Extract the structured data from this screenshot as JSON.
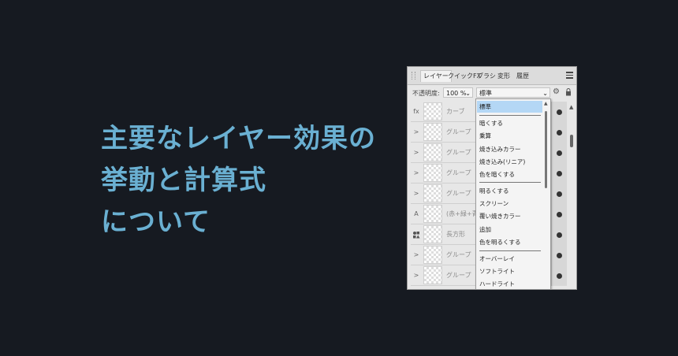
{
  "headline": {
    "line1": "主要なレイヤー効果の",
    "line2": "挙動と計算式",
    "line3": "について"
  },
  "panel": {
    "tabs": [
      "レイヤー",
      "クイックFX",
      "ブラシ",
      "変形",
      "履歴"
    ],
    "opacity_label": "不透明度:",
    "opacity_value": "100 %",
    "blend_mode": "標準",
    "layers": [
      {
        "icon": "fx",
        "name": "カーブ"
      },
      {
        "icon": ">",
        "name": "グループ"
      },
      {
        "icon": ">",
        "name": "グループ"
      },
      {
        "icon": ">",
        "name": "グループ"
      },
      {
        "icon": ">",
        "name": "グループ"
      },
      {
        "icon": "A",
        "name": "(赤+緑+青"
      },
      {
        "icon": "shape",
        "name": "長方形"
      },
      {
        "icon": ">",
        "name": "グループ"
      },
      {
        "icon": ">",
        "name": "グループ"
      }
    ],
    "blend_options": [
      "標準",
      "暗くする",
      "乗算",
      "焼き込みカラー",
      "焼き込み(リニア)",
      "色を暗くする",
      "明るくする",
      "スクリーン",
      "覆い焼きカラー",
      "追加",
      "色を明るくする",
      "オーバーレイ",
      "ソフトライト",
      "ハードライト"
    ]
  }
}
